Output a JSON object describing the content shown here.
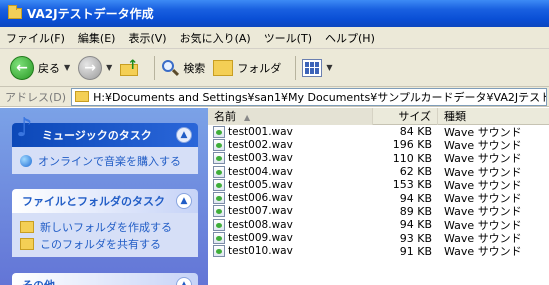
{
  "window": {
    "title": "VA2Jテストデータ作成"
  },
  "menu": [
    "ファイル(F)",
    "編集(E)",
    "表示(V)",
    "お気に入り(A)",
    "ツール(T)",
    "ヘルプ(H)"
  ],
  "toolbar": {
    "back_label": "戻る",
    "search_label": "検索",
    "folders_label": "フォルダ"
  },
  "address": {
    "label": "アドレス(D)",
    "path": "H:¥Documents and Settings¥san1¥My Documents¥サンプルカードデータ¥VA2Jテストデータ作成"
  },
  "taskpane": {
    "music": {
      "title": "ミュージックのタスク",
      "tasks": [
        "オンラインで音楽を購入する"
      ]
    },
    "filefolder": {
      "title": "ファイルとフォルダのタスク",
      "tasks": [
        "新しいフォルダを作成する",
        "このフォルダを共有する"
      ]
    },
    "other": {
      "title": "その他"
    }
  },
  "filelist": {
    "columns": {
      "name": "名前",
      "size": "サイズ",
      "type": "種類"
    },
    "files": [
      {
        "name": "test001.wav",
        "size": "84 KB",
        "type": "Wave サウンド"
      },
      {
        "name": "test002.wav",
        "size": "196 KB",
        "type": "Wave サウンド"
      },
      {
        "name": "test003.wav",
        "size": "110 KB",
        "type": "Wave サウンド"
      },
      {
        "name": "test004.wav",
        "size": "62 KB",
        "type": "Wave サウンド"
      },
      {
        "name": "test005.wav",
        "size": "153 KB",
        "type": "Wave サウンド"
      },
      {
        "name": "test006.wav",
        "size": "94 KB",
        "type": "Wave サウンド"
      },
      {
        "name": "test007.wav",
        "size": "89 KB",
        "type": "Wave サウンド"
      },
      {
        "name": "test008.wav",
        "size": "94 KB",
        "type": "Wave サウンド"
      },
      {
        "name": "test009.wav",
        "size": "93 KB",
        "type": "Wave サウンド"
      },
      {
        "name": "test010.wav",
        "size": "91 KB",
        "type": "Wave サウンド"
      }
    ]
  }
}
